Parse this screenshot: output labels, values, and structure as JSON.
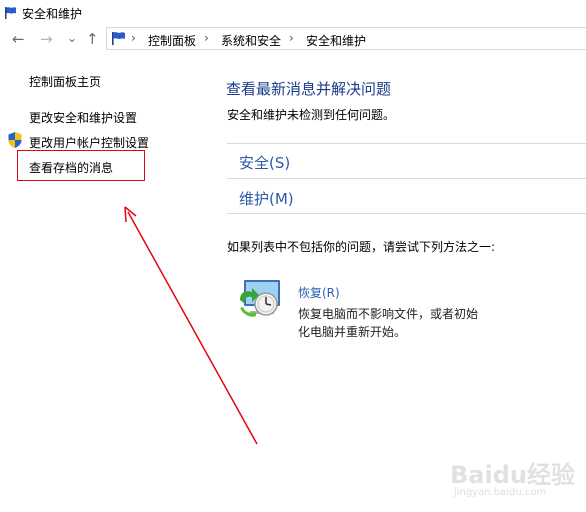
{
  "window": {
    "title": "安全和维护"
  },
  "nav": {
    "back": "←",
    "forward": "→",
    "recent": "⌄",
    "up": "↑"
  },
  "breadcrumb": {
    "items": [
      "控制面板",
      "系统和安全",
      "安全和维护"
    ],
    "separator": "›"
  },
  "sidebar": {
    "home": "控制面板主页",
    "items": [
      "更改安全和维护设置",
      "更改用户帐户控制设置",
      "查看存档的消息"
    ]
  },
  "main": {
    "title": "查看最新消息并解决问题",
    "subtitle": "安全和维护未检测到任何问题。",
    "sections": [
      "安全(S)",
      "维护(M)"
    ],
    "hint": "如果列表中不包括你的问题，请尝试下列方法之一:",
    "recovery": {
      "link": "恢复(R)",
      "desc_line1": "恢复电脑而不影响文件，或者初始",
      "desc_line2": "化电脑并重新开始。"
    }
  },
  "watermark": {
    "logo": "Baidu经验",
    "url": "jingyan.baidu.com"
  },
  "colors": {
    "link": "#2b5fb3",
    "heading": "#1a3b8c",
    "highlight": "#e30613"
  },
  "icons": [
    "flag-icon",
    "back-arrow-icon",
    "forward-arrow-icon",
    "recent-dropdown-icon",
    "up-arrow-icon",
    "shield-icon",
    "recovery-icon"
  ]
}
